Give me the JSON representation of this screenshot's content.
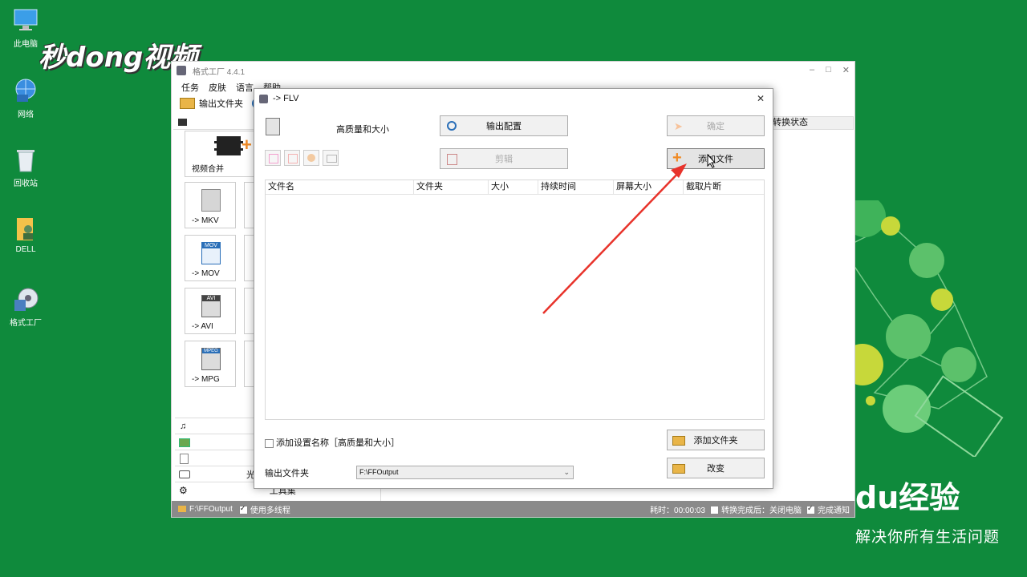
{
  "desktop": {
    "icons": [
      {
        "label": "此电脑",
        "icon": "computer-icon"
      },
      {
        "label": "网络",
        "icon": "network-icon"
      },
      {
        "label": "回收站",
        "icon": "recycle-bin-icon"
      },
      {
        "label": "DELL",
        "icon": "user-folder-icon"
      },
      {
        "label": "格式工厂",
        "icon": "format-factory-icon"
      }
    ],
    "watermark": "秒dong视频",
    "baidu_logo": "du经验",
    "baidu_slogan": "解决你所有生活问题"
  },
  "main_window": {
    "title": "格式工厂 4.4.1",
    "menu": [
      "任务",
      "皮肤",
      "语言",
      "帮助"
    ],
    "toolbar_output_folder": "输出文件夹",
    "task_header": "转换状态",
    "categories": [
      {
        "label": "视频合并"
      },
      {
        "label": "-> MKV",
        "badge": ""
      },
      {
        "label": "-> MOV",
        "badge": "MOV"
      },
      {
        "label": "-> AVI",
        "badge": "AVI"
      },
      {
        "label": "-> MPG",
        "badge": "MPEG"
      }
    ],
    "side_rows": [
      "",
      "",
      "",
      "光驱",
      "工具集"
    ],
    "status": {
      "output_path": "F:\\FFOutput",
      "multithread_label": "使用多线程",
      "elapsed": "耗时：00:00:03",
      "after_convert_label": "转换完成后：关闭电脑",
      "notify_label": "完成通知"
    }
  },
  "dialog": {
    "title": "-> FLV",
    "profile_label": "高质量和大小",
    "buttons": {
      "output_config": "输出配置",
      "ok": "确定",
      "clip": "剪辑",
      "add_file": "添加文件",
      "add_folder": "添加文件夹",
      "change": "改变"
    },
    "columns": [
      "文件名",
      "文件夹",
      "大小",
      "持续时间",
      "屏幕大小",
      "截取片断"
    ],
    "add_setting_name": "添加设置名称［高质量和大小］",
    "output_folder_label": "输出文件夹",
    "output_folder_value": "F:\\FFOutput"
  },
  "colors": {
    "desktop_bg": "#0f8a3c",
    "arrow": "#e8332b",
    "accent_orange": "#f08a24"
  }
}
